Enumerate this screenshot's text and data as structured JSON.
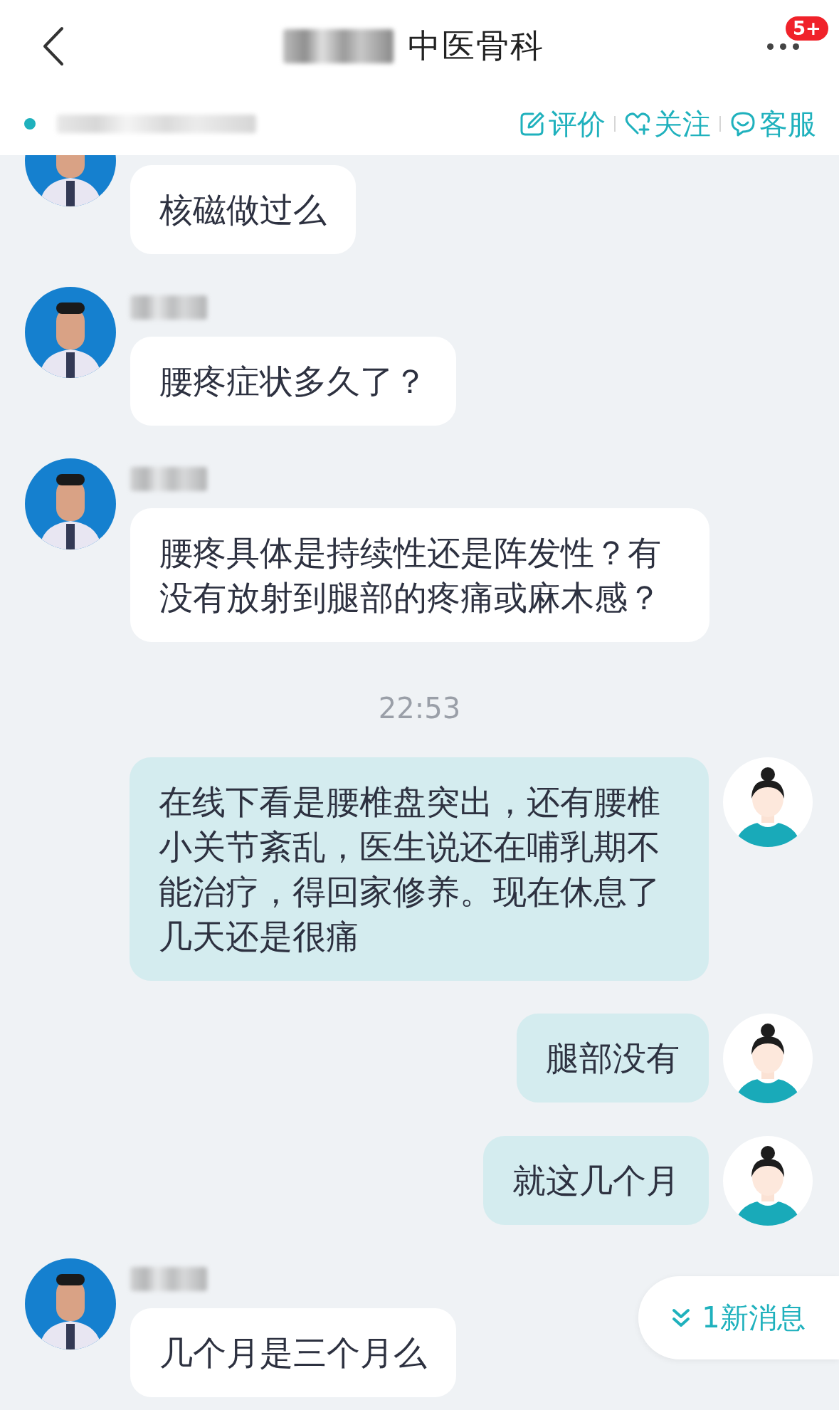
{
  "header": {
    "title": "中医骨科",
    "badge": "5+"
  },
  "subbar": {
    "online": true,
    "actions": [
      {
        "kind": "review",
        "label": "评价"
      },
      {
        "kind": "follow",
        "label": "关注"
      },
      {
        "kind": "service",
        "label": "客服"
      }
    ]
  },
  "messages": [
    {
      "kind": "incoming",
      "text": "核磁做过么"
    },
    {
      "kind": "incoming",
      "text": "腰疼症状多久了？"
    },
    {
      "kind": "incoming",
      "text": "腰疼具体是持续性还是阵发性？有没有放射到腿部的疼痛或麻木感？"
    },
    {
      "kind": "time",
      "text": "22:53"
    },
    {
      "kind": "outgoing",
      "text": "在线下看是腰椎盘突出，还有腰椎小关节紊乱，医生说还在哺乳期不能治疗，得回家修养。现在休息了几天还是很痛"
    },
    {
      "kind": "outgoing",
      "text": "腿部没有"
    },
    {
      "kind": "outgoing",
      "text": "就这几个月"
    },
    {
      "kind": "incoming",
      "text": "几个月是三个月么"
    }
  ],
  "new_messages": {
    "label": "1新消息"
  }
}
